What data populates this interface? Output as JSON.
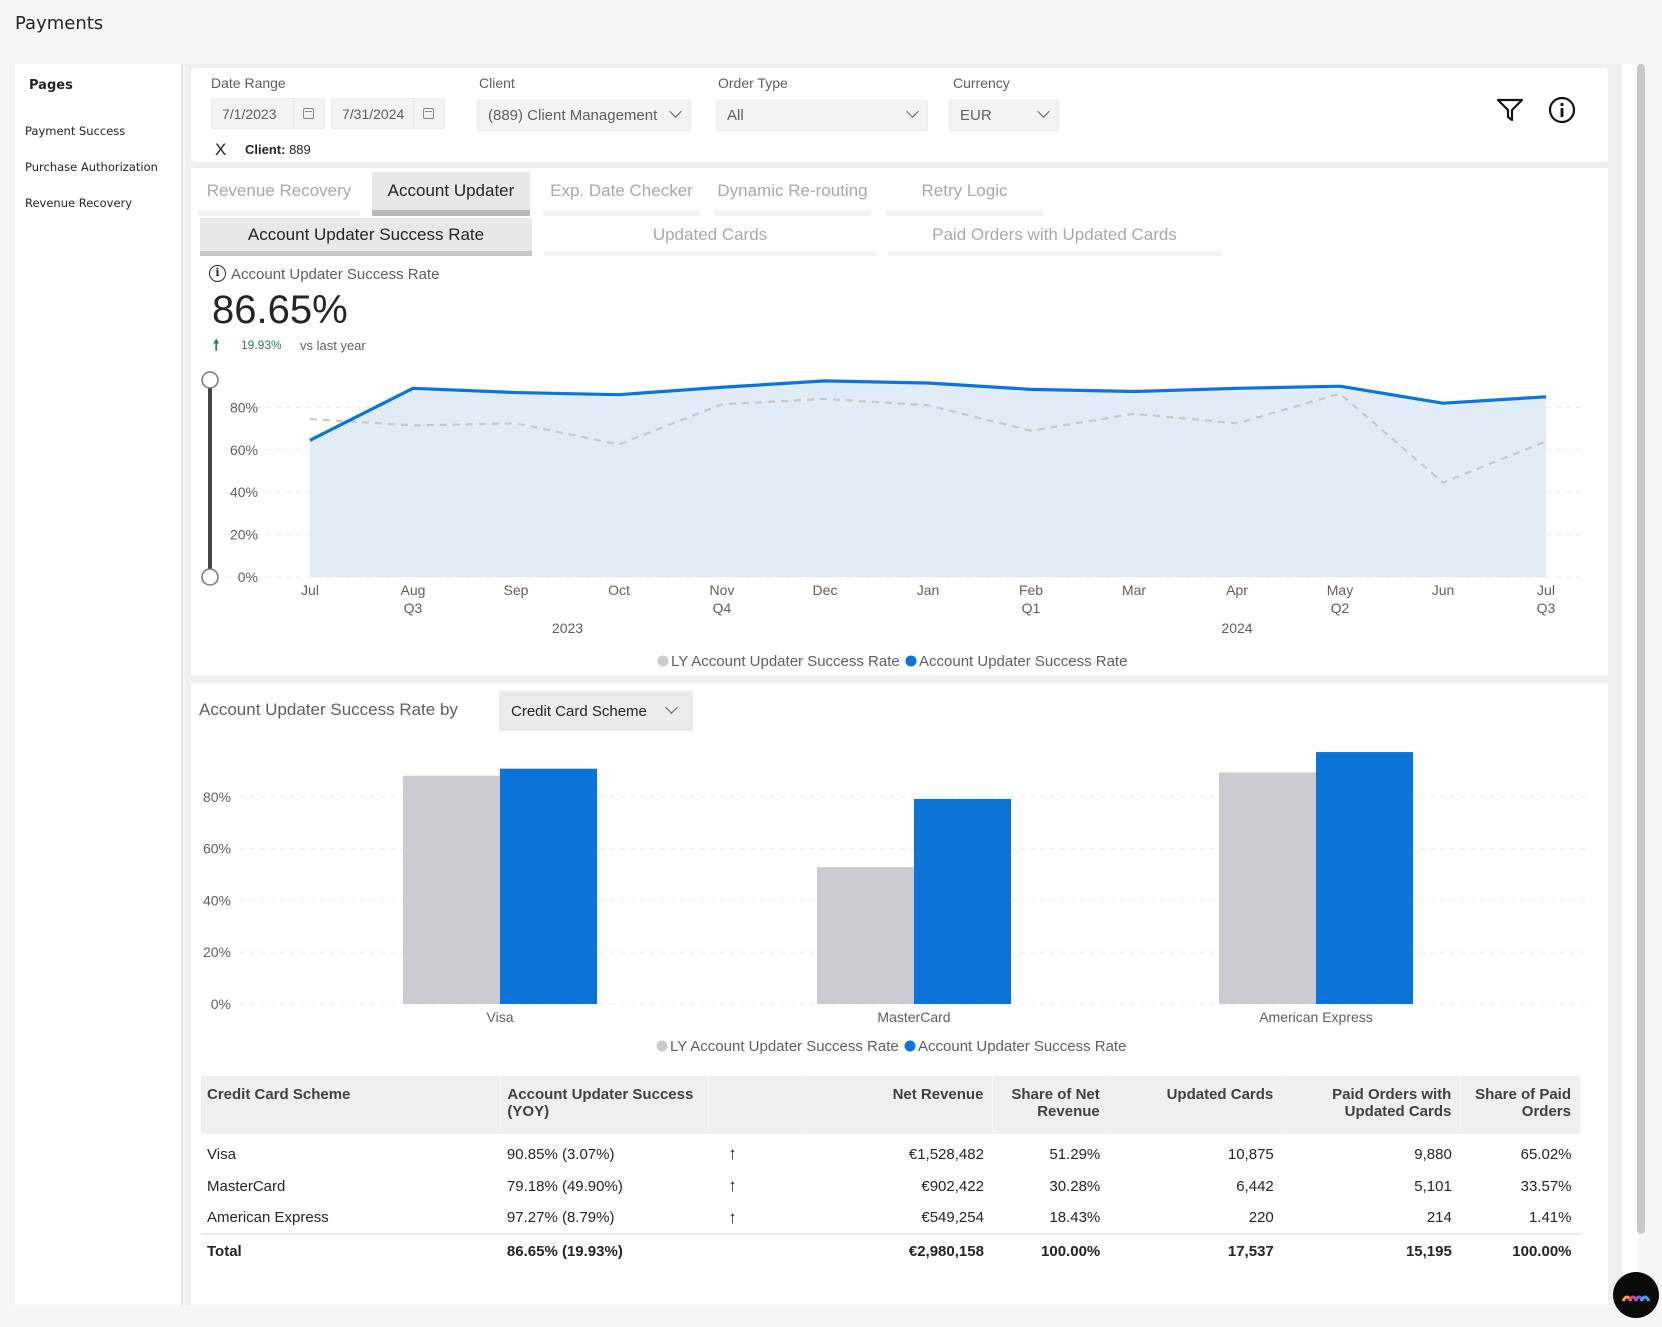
{
  "app": {
    "title": "Payments"
  },
  "sidebar": {
    "title": "Pages",
    "items": [
      {
        "label": "Payment Success"
      },
      {
        "label": "Purchase Authorization"
      },
      {
        "label": "Revenue Recovery"
      }
    ]
  },
  "filters": {
    "date_range": {
      "label": "Date Range",
      "start": "7/1/2023",
      "end": "7/31/2024"
    },
    "client": {
      "label": "Client",
      "value": "(889) Client Management"
    },
    "order_type": {
      "label": "Order Type",
      "value": "All"
    },
    "currency": {
      "label": "Currency",
      "value": "EUR"
    },
    "active_chip": {
      "remove_label": "X",
      "key": "Client:",
      "value": "889"
    },
    "icons": [
      "filter-icon",
      "info-icon"
    ]
  },
  "tabs": [
    {
      "label": "Revenue Recovery",
      "active": false
    },
    {
      "label": "Account Updater",
      "active": true
    },
    {
      "label": "Exp. Date Checker",
      "active": false
    },
    {
      "label": "Dynamic Re-routing",
      "active": false
    },
    {
      "label": "Retry Logic",
      "active": false
    }
  ],
  "subtabs": [
    {
      "label": "Account Updater Success Rate",
      "active": true
    },
    {
      "label": "Updated Cards",
      "active": false
    },
    {
      "label": "Paid Orders with Updated Cards",
      "active": false
    }
  ],
  "kpi": {
    "label": "Account Updater Success Rate",
    "value": "86.65%",
    "change": "19.93%",
    "change_direction": "up",
    "comparison": "vs last year"
  },
  "colors": {
    "current": "#0b74d9",
    "last_year": "#c8cbcf",
    "area_fill": "#dde9f6",
    "positive": "#2e7d4f"
  },
  "chart_data": [
    {
      "type": "area",
      "title": "Account Updater Success Rate",
      "x": [
        "Jul",
        "Aug",
        "Sep",
        "Oct",
        "Nov",
        "Dec",
        "Jan",
        "Feb",
        "Mar",
        "Apr",
        "May",
        "Jun",
        "Jul"
      ],
      "x_quarter_labels": [
        "",
        "Q3",
        "",
        "",
        "Q4",
        "",
        "",
        "Q1",
        "",
        "",
        "Q2",
        "",
        "Q3"
      ],
      "x_year_labels": [
        {
          "label": "2023",
          "at_index": 2.5
        },
        {
          "label": "2024",
          "at_index": 9
        }
      ],
      "series": [
        {
          "name": "LY Account Updater Success Rate",
          "style": "dashed",
          "values": [
            74.5,
            71.5,
            72.5,
            62.5,
            81.5,
            84,
            81,
            69,
            77,
            72.5,
            86.5,
            44.5,
            64
          ]
        },
        {
          "name": "Account Updater Success Rate",
          "style": "solid-area",
          "values": [
            64.5,
            89,
            87,
            86,
            89.5,
            92.5,
            91.5,
            88.5,
            87.5,
            89,
            90,
            82,
            85
          ]
        }
      ],
      "yticks": [
        "0%",
        "20%",
        "40%",
        "60%",
        "80%"
      ],
      "ylim": [
        0,
        100
      ],
      "grid": true,
      "legend": "bottom-center",
      "range_slider": {
        "min_fraction": 0,
        "max_fraction": 1
      }
    },
    {
      "type": "bar",
      "title": "Account Updater Success Rate by",
      "group_by": "Credit Card Scheme",
      "categories": [
        "Visa",
        "MasterCard",
        "American Express"
      ],
      "series": [
        {
          "name": "LY Account Updater Success Rate",
          "values": [
            88.14,
            52.82,
            89.41
          ]
        },
        {
          "name": "Account Updater Success Rate",
          "values": [
            90.85,
            79.18,
            97.27
          ]
        }
      ],
      "yticks": [
        "0%",
        "20%",
        "40%",
        "60%",
        "80%"
      ],
      "ylim": [
        0,
        100
      ],
      "grid": true,
      "legend": "bottom-center"
    }
  ],
  "breakdown": {
    "dropdown_value": "Credit Card Scheme"
  },
  "table": {
    "headers": [
      "Credit Card Scheme",
      "Account Updater Success (YOY)",
      "",
      "Net Revenue",
      "Share of Net Revenue",
      "Updated Cards",
      "Paid Orders with Updated Cards",
      "Share of Paid Orders"
    ],
    "rows": [
      {
        "scheme": "Visa",
        "success": "90.85% (3.07%)",
        "trend": "↑",
        "net_revenue": "€1,528,482",
        "share_net": "51.29%",
        "updated_cards": "10,875",
        "paid_orders": "9,880",
        "share_paid": "65.02%"
      },
      {
        "scheme": "MasterCard",
        "success": "79.18% (49.90%)",
        "trend": "↑",
        "net_revenue": "€902,422",
        "share_net": "30.28%",
        "updated_cards": "6,442",
        "paid_orders": "5,101",
        "share_paid": "33.57%"
      },
      {
        "scheme": "American Express",
        "success": "97.27% (8.79%)",
        "trend": "↑",
        "net_revenue": "€549,254",
        "share_net": "18.43%",
        "updated_cards": "220",
        "paid_orders": "214",
        "share_paid": "1.41%"
      }
    ],
    "total": {
      "scheme": "Total",
      "success": "86.65% (19.93%)",
      "trend": "",
      "net_revenue": "€2,980,158",
      "share_net": "100.00%",
      "updated_cards": "17,537",
      "paid_orders": "15,195",
      "share_paid": "100.00%"
    }
  }
}
